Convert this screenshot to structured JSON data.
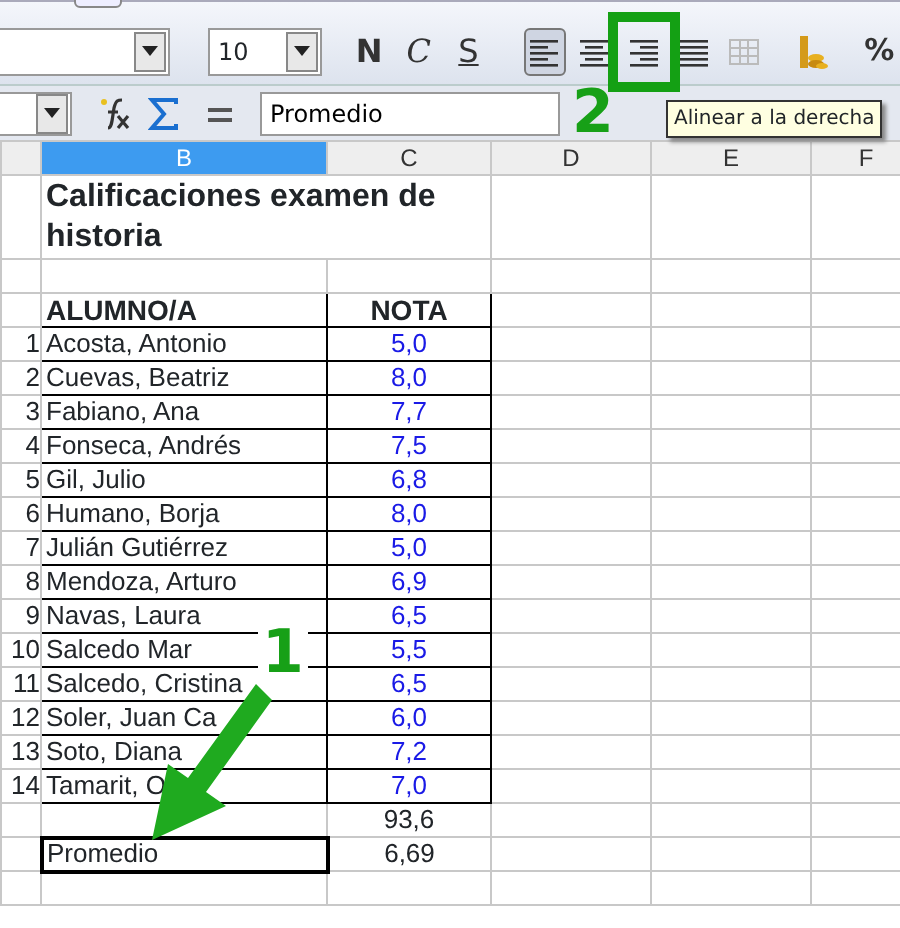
{
  "toolbar": {
    "font_size": "10",
    "format_buttons": [
      {
        "label": "N",
        "kind": "bold"
      },
      {
        "label": "C",
        "kind": "italic"
      },
      {
        "label": "S",
        "kind": "underline"
      }
    ],
    "align_buttons": [
      {
        "kind": "left",
        "selected": true,
        "disabled": false,
        "highlighted": false
      },
      {
        "kind": "center",
        "selected": false,
        "disabled": false,
        "highlighted": false
      },
      {
        "kind": "right",
        "selected": false,
        "disabled": false,
        "highlighted": true
      },
      {
        "kind": "justify",
        "selected": false,
        "disabled": false,
        "highlighted": false
      },
      {
        "kind": "grid",
        "selected": false,
        "disabled": true,
        "highlighted": false
      }
    ],
    "percent_button": "%"
  },
  "formula_bar": {
    "value": "Promedio"
  },
  "tooltip": "Alinear a la derecha",
  "columns": [
    {
      "label": "B",
      "selected": true
    },
    {
      "label": "C",
      "selected": false
    },
    {
      "label": "D",
      "selected": false
    },
    {
      "label": "E",
      "selected": false
    },
    {
      "label": "F",
      "selected": false
    }
  ],
  "sheet": {
    "title": "Calificaciones examen de historia",
    "headers": [
      "ALUMNO/A",
      "NOTA"
    ],
    "rows": [
      {
        "number": "1",
        "name": "Acosta, Antonio",
        "grade": "5,0"
      },
      {
        "number": "2",
        "name": "Cuevas, Beatriz",
        "grade": "8,0"
      },
      {
        "number": "3",
        "name": "Fabiano, Ana",
        "grade": "7,7"
      },
      {
        "number": "4",
        "name": "Fonseca, Andrés",
        "grade": "7,5"
      },
      {
        "number": "5",
        "name": "Gil, Julio",
        "grade": "6,8"
      },
      {
        "number": "6",
        "name": "Humano, Borja",
        "grade": "8,0"
      },
      {
        "number": "7",
        "name": "Julián Gutiérrez",
        "grade": "5,0"
      },
      {
        "number": "8",
        "name": "Mendoza, Arturo",
        "grade": "6,9"
      },
      {
        "number": "9",
        "name": "Navas, Laura",
        "grade": "6,5"
      },
      {
        "number": "10",
        "name": "Salcedo Mar",
        "grade": "5,5"
      },
      {
        "number": "11",
        "name": "Salcedo, Cristina",
        "grade": "6,5"
      },
      {
        "number": "12",
        "name": "Soler, Juan Ca",
        "grade": "6,0"
      },
      {
        "number": "13",
        "name": "Soto, Diana",
        "grade": "7,2"
      },
      {
        "number": "14",
        "name": "Tamarit, O",
        "grade": "7,0"
      }
    ],
    "total": "93,6",
    "average_label": "Promedio",
    "average": "6,69"
  },
  "annotations": [
    {
      "label": "1",
      "kind": "arrow"
    },
    {
      "label": "2",
      "kind": "box"
    }
  ]
}
